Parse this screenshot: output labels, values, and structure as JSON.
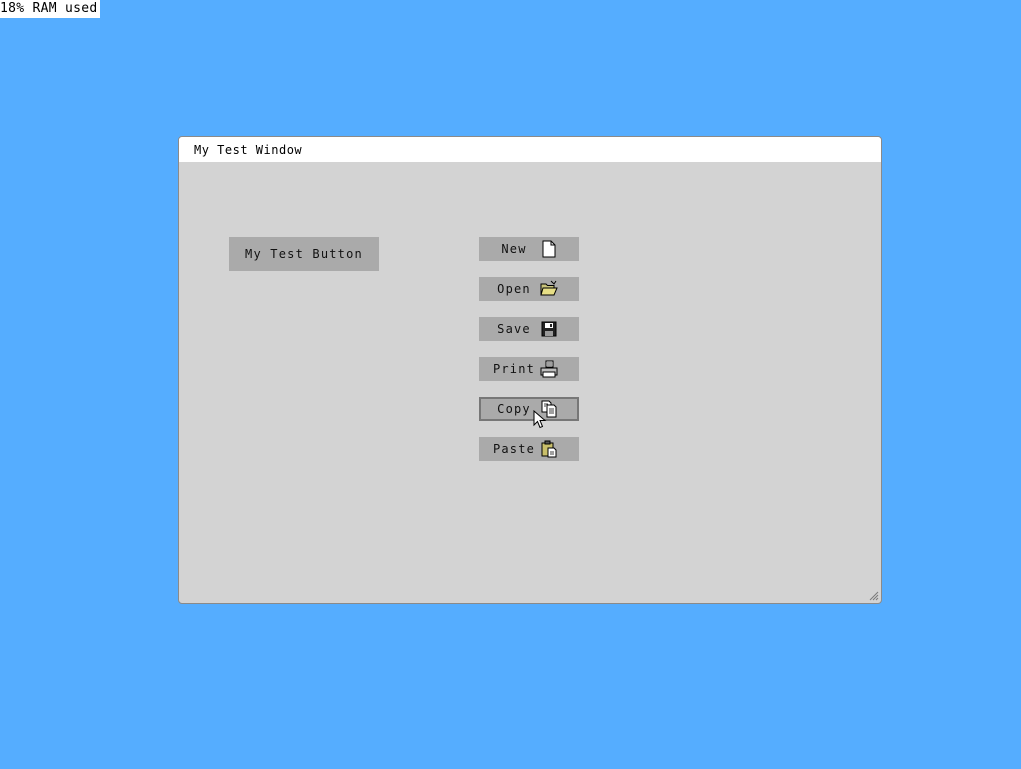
{
  "status": {
    "ram": "18% RAM used"
  },
  "window": {
    "title": "My Test Window",
    "test_button_label": "My Test Button"
  },
  "toolbar": [
    {
      "label": "New",
      "icon": "new-file-icon"
    },
    {
      "label": "Open",
      "icon": "open-folder-icon"
    },
    {
      "label": "Save",
      "icon": "save-disk-icon"
    },
    {
      "label": "Print",
      "icon": "printer-icon"
    },
    {
      "label": "Copy",
      "icon": "copy-icon",
      "focused": true
    },
    {
      "label": "Paste",
      "icon": "paste-icon"
    }
  ],
  "colors": {
    "desktop": "#55adff",
    "window_bg": "#d3d3d3",
    "button_bg": "#aaaaaa"
  }
}
